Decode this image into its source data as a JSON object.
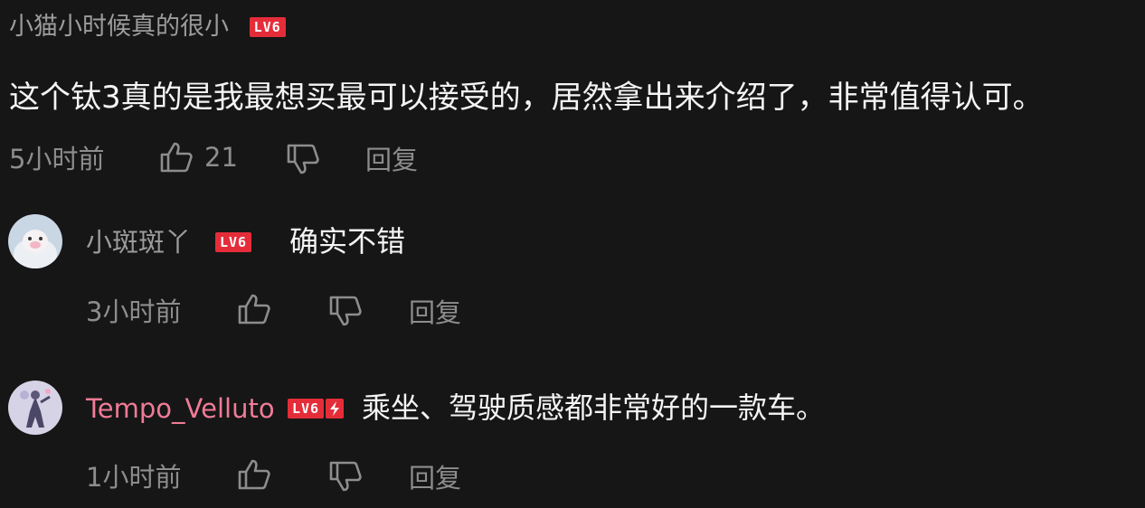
{
  "main_comment": {
    "username": "小猫小时候真的很小",
    "level": "LV6",
    "content": "这个钛3真的是我最想买最可以接受的，居然拿出来介绍了，非常值得认可。",
    "time": "5小时前",
    "like_count": "21",
    "reply_label": "回复"
  },
  "replies": [
    {
      "username": "小斑斑丫",
      "level": "LV6",
      "content": "确实不错",
      "time": "3小时前",
      "reply_label": "回复",
      "username_color": "#9c9c9c"
    },
    {
      "username": "Tempo_Velluto",
      "level": "LV6",
      "content": "乘坐、驾驶质感都非常好的一款车。",
      "time": "1小时前",
      "reply_label": "回复",
      "username_color": "#ef7b97"
    }
  ],
  "icons": {
    "like": "thumbs-up-icon",
    "dislike": "thumbs-down-icon",
    "badge_extra": "lightning-bolt-icon"
  },
  "colors": {
    "background": "#161616",
    "badge": "#e52d3a",
    "muted_text": "#8d8d8d",
    "vip_username": "#ef7b97"
  }
}
